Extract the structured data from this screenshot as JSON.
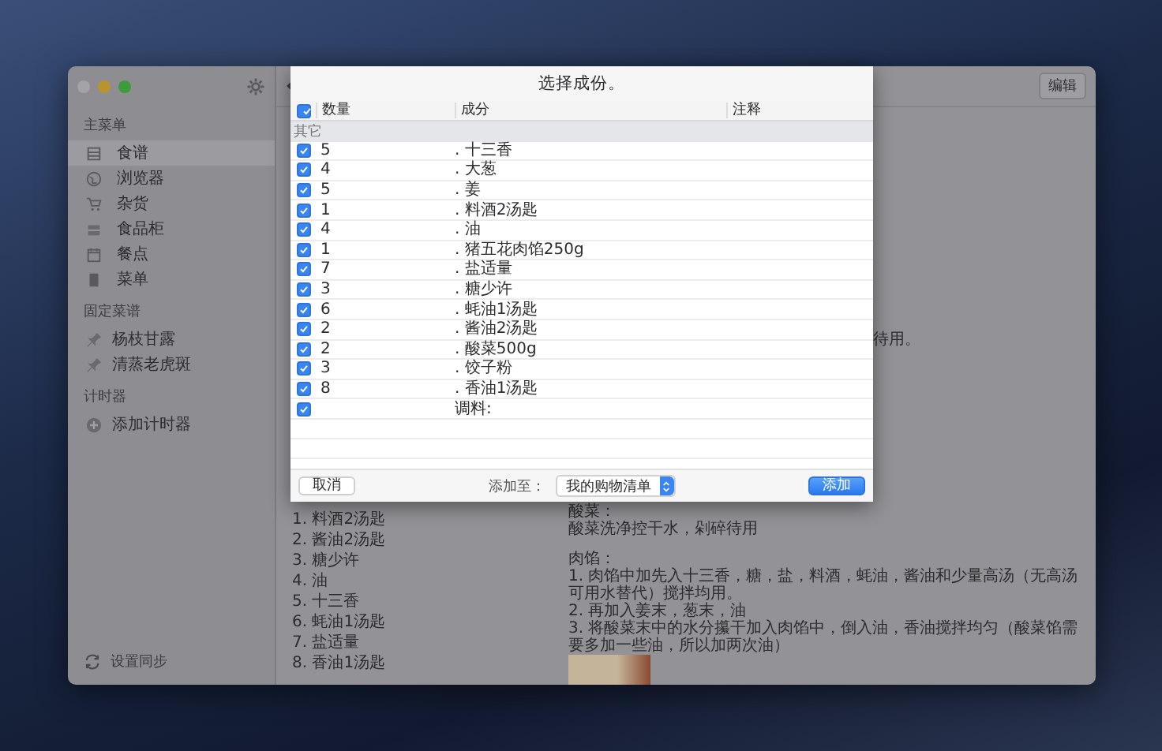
{
  "window": {
    "edit_button": "编辑"
  },
  "sidebar": {
    "sections": [
      {
        "title": "主菜单",
        "items": [
          {
            "label": "食谱",
            "selected": true
          },
          {
            "label": "浏览器",
            "selected": false
          },
          {
            "label": "杂货",
            "selected": false
          },
          {
            "label": "食品柜",
            "selected": false
          },
          {
            "label": "餐点",
            "selected": false
          },
          {
            "label": "菜单",
            "selected": false
          }
        ]
      },
      {
        "title": "固定菜谱",
        "items": [
          {
            "label": "杨枝甘露",
            "selected": false
          },
          {
            "label": "清蒸老虎斑",
            "selected": false
          }
        ]
      },
      {
        "title": "计时器",
        "items": [
          {
            "label": "添加计时器",
            "selected": false
          }
        ]
      }
    ],
    "sync": "设置同步"
  },
  "content": {
    "hidden_line_end": "待用。",
    "ingredients": [
      "1. 料酒2汤匙",
      "2. 酱油2汤匙",
      "3. 糖少许",
      "4. 油",
      "5. 十三香",
      "6. 蚝油1汤匙",
      "7. 盐适量",
      "8. 香油1汤匙"
    ],
    "sections": [
      {
        "heading": "酸菜：",
        "lines": [
          "酸菜洗净控干水，剁碎待用"
        ]
      },
      {
        "heading": "肉馅：",
        "lines": [
          "1. 肉馅中加先入十三香，糖，盐，料酒，蚝油，酱油和少量高汤（无高汤可用水替代）搅拌均用。",
          "2. 再加入姜末，葱末，油",
          "3. 将酸菜末中的水分攥干加入肉馅中，倒入油，香油搅拌均匀（酸菜馅需要多加一些油，所以加两次油）"
        ]
      }
    ]
  },
  "sheet": {
    "title": "选择成份。",
    "all_checked": true,
    "columns": [
      "数量",
      "成分",
      "注释"
    ],
    "group": "其它",
    "rows": [
      {
        "checked": true,
        "quantity": "5",
        "ingredient": ". 十三香"
      },
      {
        "checked": true,
        "quantity": "4",
        "ingredient": ". 大葱"
      },
      {
        "checked": true,
        "quantity": "5",
        "ingredient": ". 姜"
      },
      {
        "checked": true,
        "quantity": "1",
        "ingredient": ". 料酒2汤匙"
      },
      {
        "checked": true,
        "quantity": "4",
        "ingredient": ". 油"
      },
      {
        "checked": true,
        "quantity": "1",
        "ingredient": ". 猪五花肉馅250g"
      },
      {
        "checked": true,
        "quantity": "7",
        "ingredient": ". 盐适量"
      },
      {
        "checked": true,
        "quantity": "3",
        "ingredient": ". 糖少许"
      },
      {
        "checked": true,
        "quantity": "6",
        "ingredient": ". 蚝油1汤匙"
      },
      {
        "checked": true,
        "quantity": "2",
        "ingredient": ". 酱油2汤匙"
      },
      {
        "checked": true,
        "quantity": "2",
        "ingredient": ". 酸菜500g"
      },
      {
        "checked": true,
        "quantity": "3",
        "ingredient": ". 饺子粉"
      },
      {
        "checked": true,
        "quantity": "8",
        "ingredient": ". 香油1汤匙"
      },
      {
        "checked": true,
        "ingredient": "调料:"
      }
    ],
    "cancel": "取消",
    "add_to_label": "添加至：",
    "list_select": "我的购物清单",
    "add": "添加"
  }
}
